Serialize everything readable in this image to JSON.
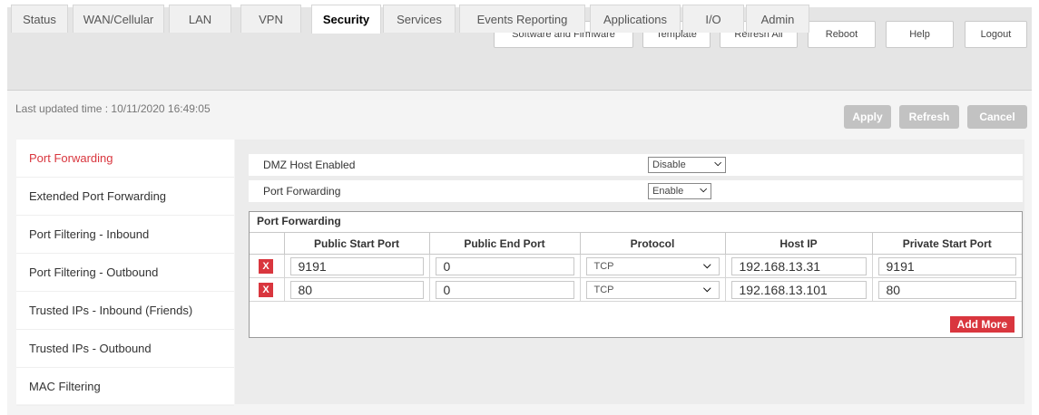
{
  "topbar": {
    "buttons": [
      "Software and Firmware",
      "Template",
      "Refresh All",
      "Reboot",
      "Help",
      "Logout"
    ]
  },
  "tabs": [
    {
      "label": "Status"
    },
    {
      "label": "WAN/Cellular"
    },
    {
      "label": "LAN"
    },
    {
      "label": "VPN"
    },
    {
      "label": "Security"
    },
    {
      "label": "Services"
    },
    {
      "label": "Events Reporting"
    },
    {
      "label": "Applications"
    },
    {
      "label": "I/O"
    },
    {
      "label": "Admin"
    }
  ],
  "active_tab": "Security",
  "last_updated": "Last updated time : 10/11/2020 16:49:05",
  "actions": {
    "apply": "Apply",
    "refresh": "Refresh",
    "cancel": "Cancel"
  },
  "sidebar": {
    "items": [
      {
        "label": "Port Forwarding"
      },
      {
        "label": "Extended Port Forwarding"
      },
      {
        "label": "Port Filtering - Inbound"
      },
      {
        "label": "Port Filtering - Outbound"
      },
      {
        "label": "Trusted IPs - Inbound (Friends)"
      },
      {
        "label": "Trusted IPs - Outbound"
      },
      {
        "label": "MAC Filtering"
      }
    ],
    "active": "Port Forwarding"
  },
  "settings": {
    "dmz_label": "DMZ Host Enabled",
    "dmz_value": "Disable",
    "pf_label": "Port Forwarding",
    "pf_value": "Enable"
  },
  "pf_table": {
    "title": "Port Forwarding",
    "columns": [
      "Public Start Port",
      "Public End Port",
      "Protocol",
      "Host IP",
      "Private Start Port"
    ],
    "delete_label": "X",
    "rows": [
      {
        "public_start": "9191",
        "public_end": "0",
        "protocol": "TCP",
        "host_ip": "192.168.13.31",
        "private_start": "9191"
      },
      {
        "public_start": "80",
        "public_end": "0",
        "protocol": "TCP",
        "host_ip": "192.168.13.101",
        "private_start": "80"
      }
    ],
    "add_more": "Add More"
  },
  "icons": {
    "dropdown": "chevron-down-icon",
    "delete": "delete-icon"
  },
  "colors": {
    "accent": "#d9363e",
    "disabled_button": "#c2c2c2",
    "header_bg": "#e5e5e5"
  }
}
